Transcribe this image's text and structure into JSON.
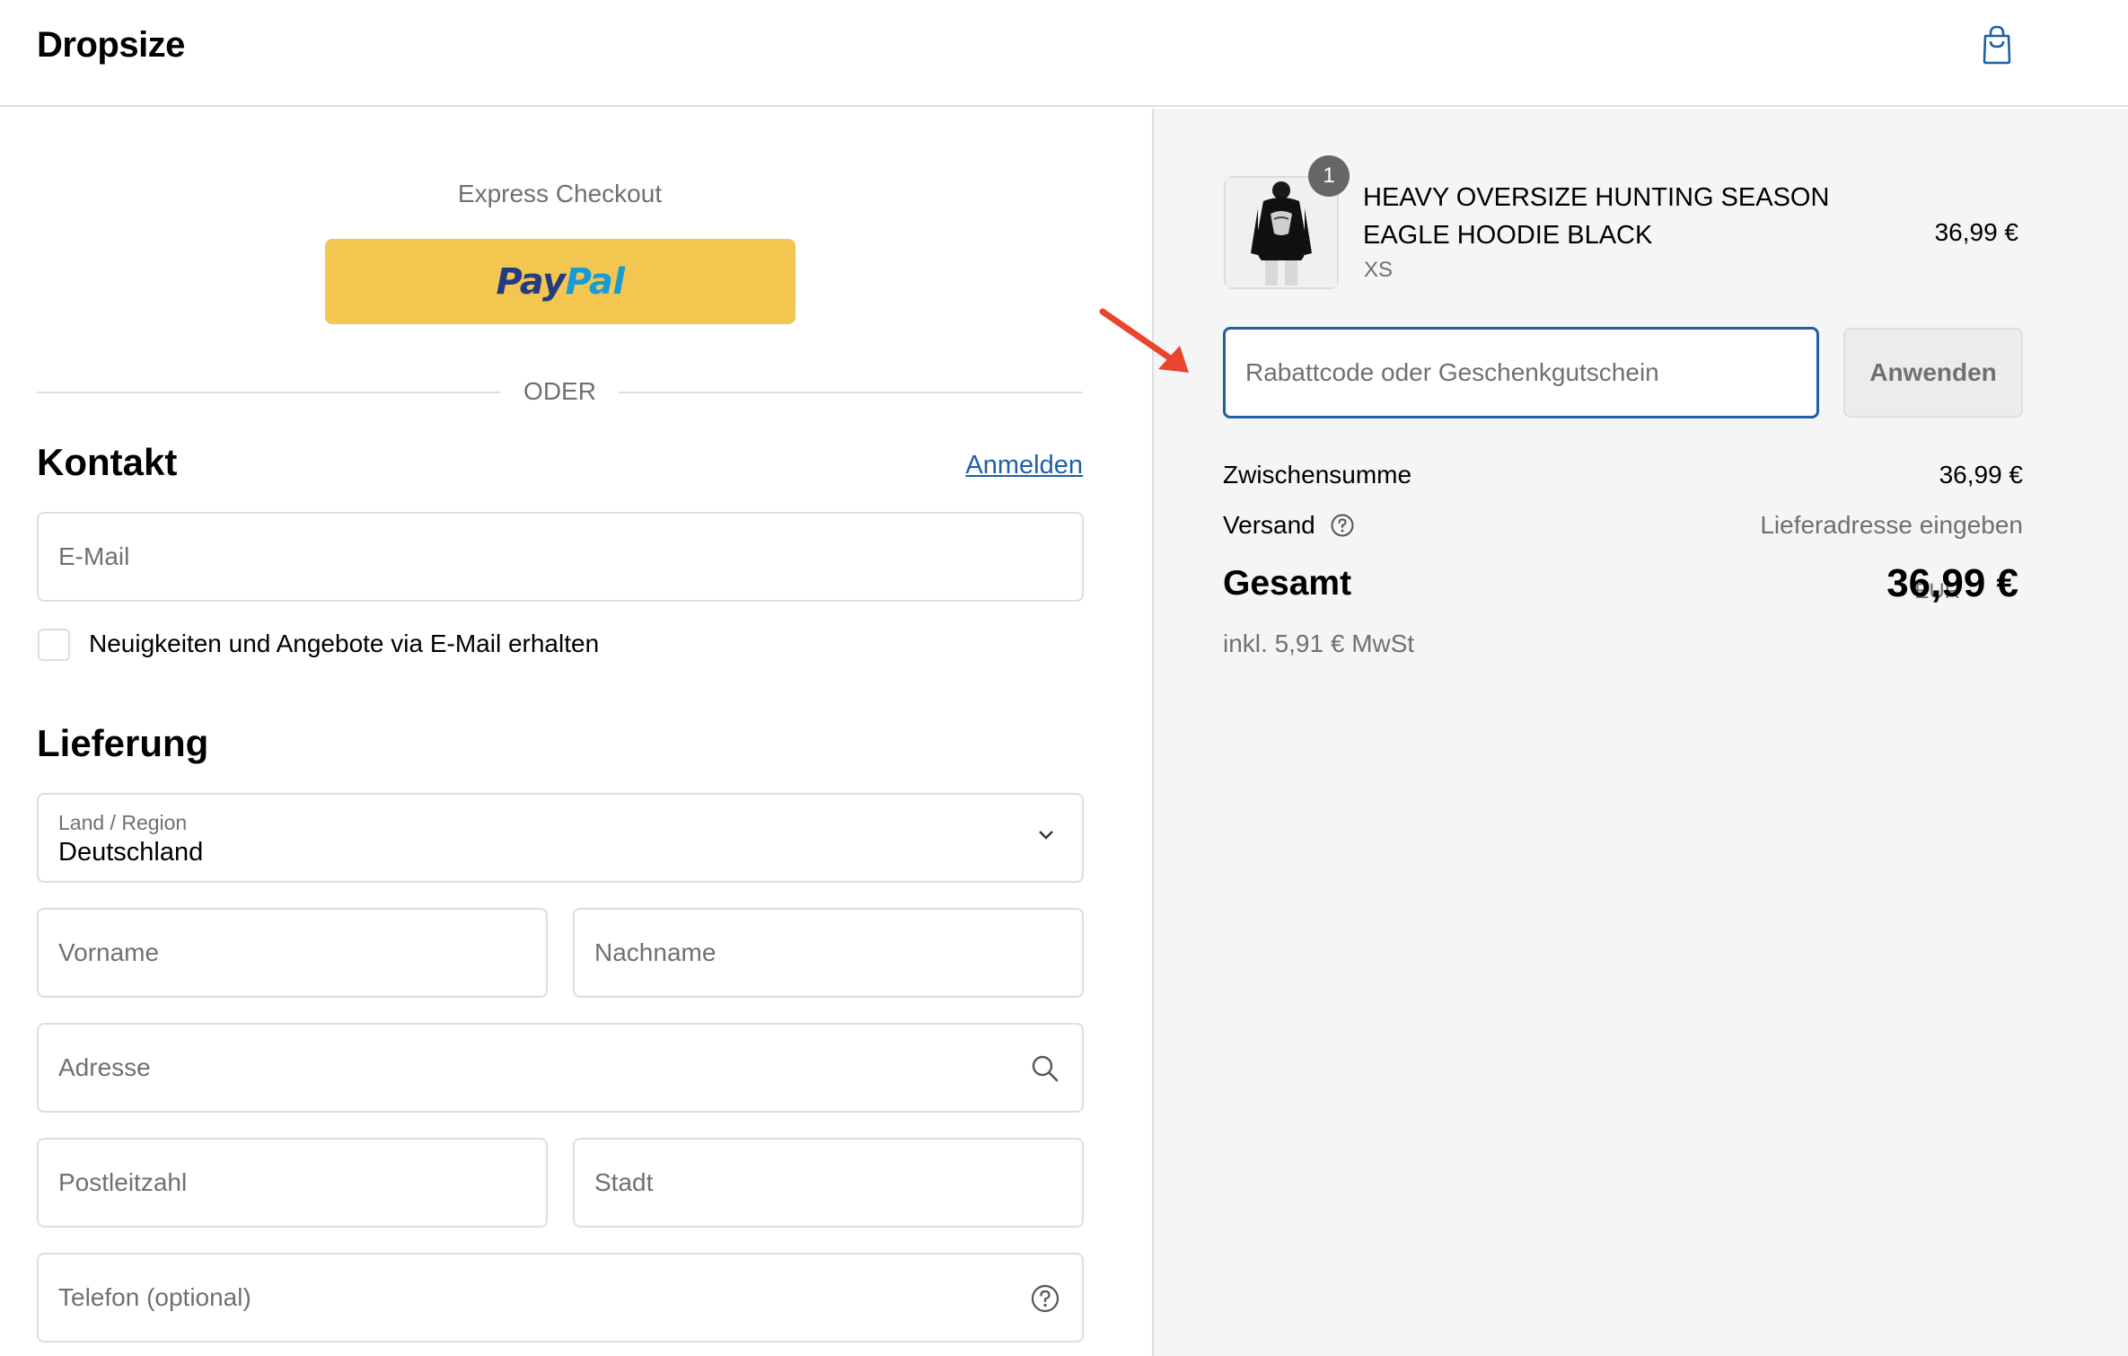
{
  "header": {
    "brand": "Dropsize",
    "cart_icon": "shopping-bag-icon"
  },
  "express": {
    "label": "Express Checkout",
    "paypal_part1": "Pay",
    "paypal_part2": "Pal",
    "divider_text": "ODER"
  },
  "contact": {
    "title": "Kontakt",
    "login_link": "Anmelden",
    "email_placeholder": "E-Mail",
    "newsletter_label": "Neuigkeiten und Angebote via E-Mail erhalten",
    "newsletter_checked": false
  },
  "delivery": {
    "title": "Lieferung",
    "country_label": "Land / Region",
    "country_value": "Deutschland",
    "first_name_placeholder": "Vorname",
    "last_name_placeholder": "Nachname",
    "address_placeholder": "Adresse",
    "postal_placeholder": "Postleitzahl",
    "city_placeholder": "Stadt",
    "phone_placeholder": "Telefon (optional)"
  },
  "order": {
    "item": {
      "quantity": "1",
      "name": "HEAVY OVERSIZE HUNTING SEASON EAGLE HOODIE BLACK",
      "variant": "XS",
      "price": "36,99 €"
    },
    "discount_placeholder": "Rabattcode oder Geschenkgutschein",
    "apply_label": "Anwenden",
    "subtotal_label": "Zwischensumme",
    "subtotal_value": "36,99 €",
    "shipping_label": "Versand",
    "shipping_value": "Lieferadresse eingeben",
    "total_label": "Gesamt",
    "total_currency": "EUR",
    "total_value": "36,99 €",
    "tax_note": "inkl. 5,91 € MwSt"
  },
  "colors": {
    "accent": "#1e5fa8",
    "paypal_yellow": "#f3c650",
    "annotation_arrow": "#e8452c"
  }
}
